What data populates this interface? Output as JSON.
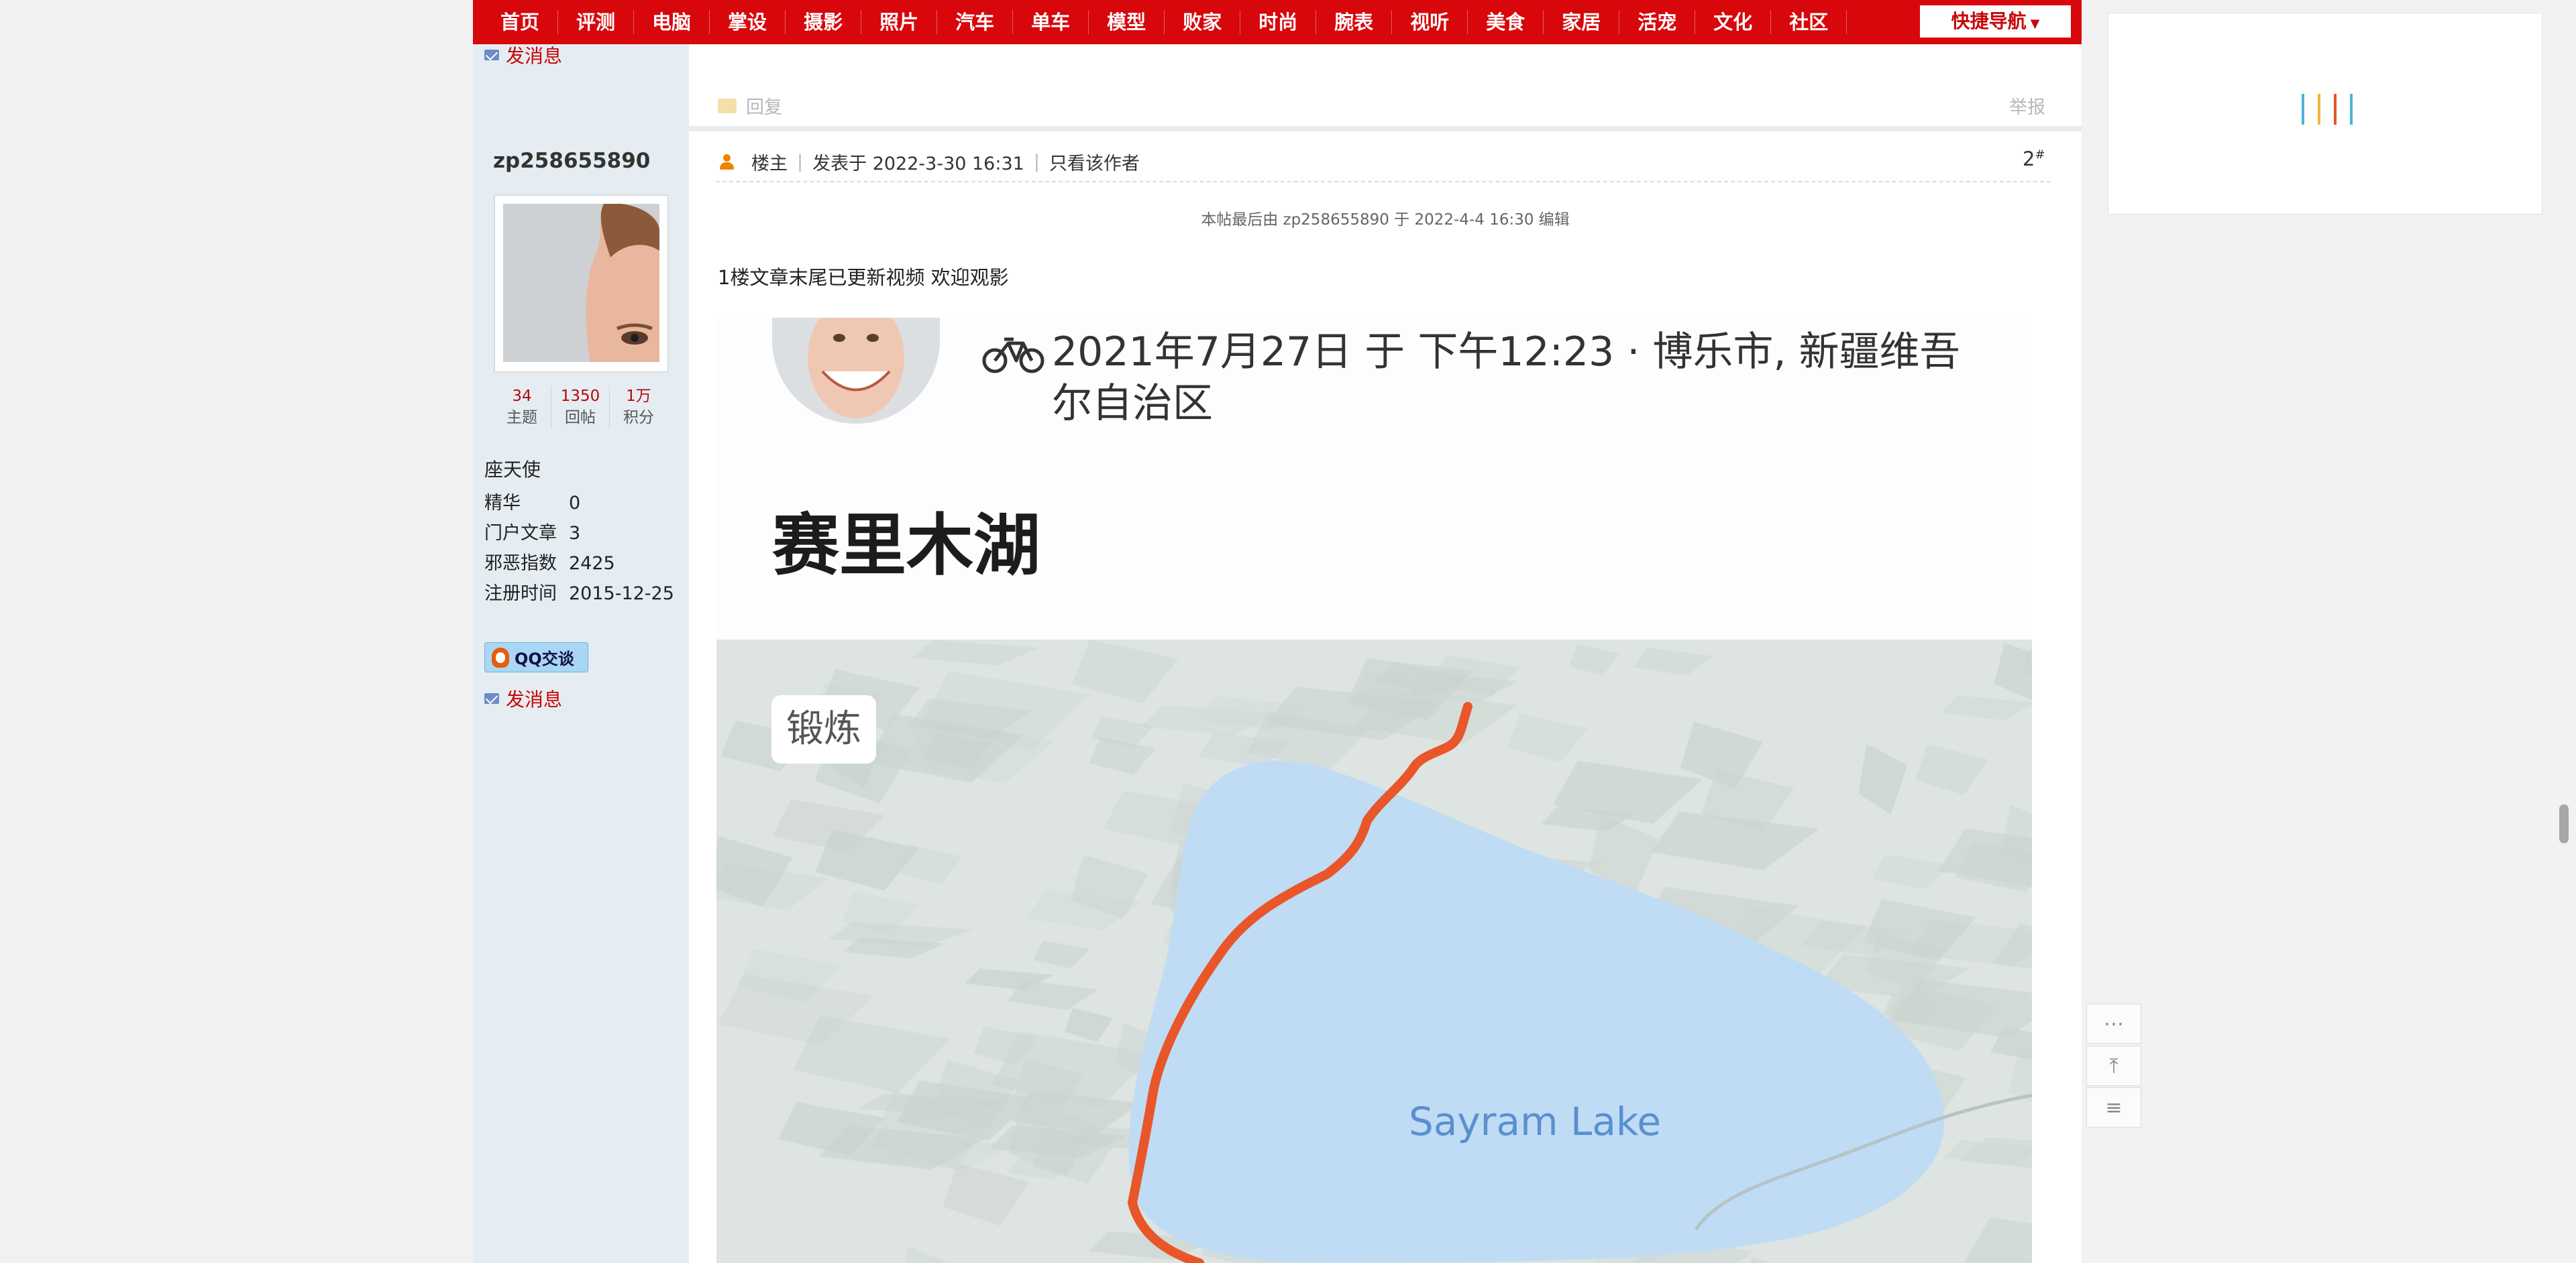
{
  "nav": {
    "items": [
      "首页",
      "评测",
      "电脑",
      "掌设",
      "摄影",
      "照片",
      "汽车",
      "单车",
      "模型",
      "败家",
      "时尚",
      "腕表",
      "视听",
      "美食",
      "家居",
      "活宠",
      "文化",
      "社区"
    ],
    "quick_nav_label": "快捷导航"
  },
  "prev_post": {
    "send_message": "发消息"
  },
  "post_actions": {
    "reply": "回复",
    "report": "举报"
  },
  "author": {
    "username": "zp258655890",
    "stats": [
      {
        "value": "34",
        "label": "主题"
      },
      {
        "value": "1350",
        "label": "回帖"
      },
      {
        "value": "1万",
        "label": "积分"
      }
    ],
    "rank": "座天使",
    "profile": [
      {
        "key": "精华",
        "value": "0"
      },
      {
        "key": "门户文章",
        "value": "3"
      },
      {
        "key": "邪恶指数",
        "value": "2425"
      },
      {
        "key": "注册时间",
        "value": "2015-12-25"
      }
    ],
    "qq_label": "QQ交谈",
    "send_message": "发消息"
  },
  "post": {
    "role": "楼主",
    "posted_at": "发表于 2022-3-30 16:31",
    "only_author": "只看该作者",
    "floor": "2",
    "floor_suffix": "#",
    "edit_note": "本帖最后由 zp258655890 于 2022-4-4 16:30 编辑",
    "text": "1楼文章末尾已更新视频 欢迎观影"
  },
  "post_image": {
    "date_location": "2021年7月27日 于 下午12:23 · 博乐市, 新疆维吾尔自治区",
    "title": "赛里木湖",
    "activity_chip": "锻炼",
    "lake_label": "Sayram Lake",
    "colors": {
      "route": "#e8562a",
      "lake": "#bfdcf4",
      "terrain": "#c9d3cf"
    }
  },
  "ad": {
    "bar_colors": [
      "#4fb2d8",
      "#f4b63a",
      "#e5542a",
      "#4fb2d8"
    ]
  },
  "float_tools": [
    {
      "icon": "comment-icon",
      "glyph": "⋯"
    },
    {
      "icon": "back-to-top-icon",
      "glyph": "⤒"
    },
    {
      "icon": "list-icon",
      "glyph": "≡"
    }
  ]
}
